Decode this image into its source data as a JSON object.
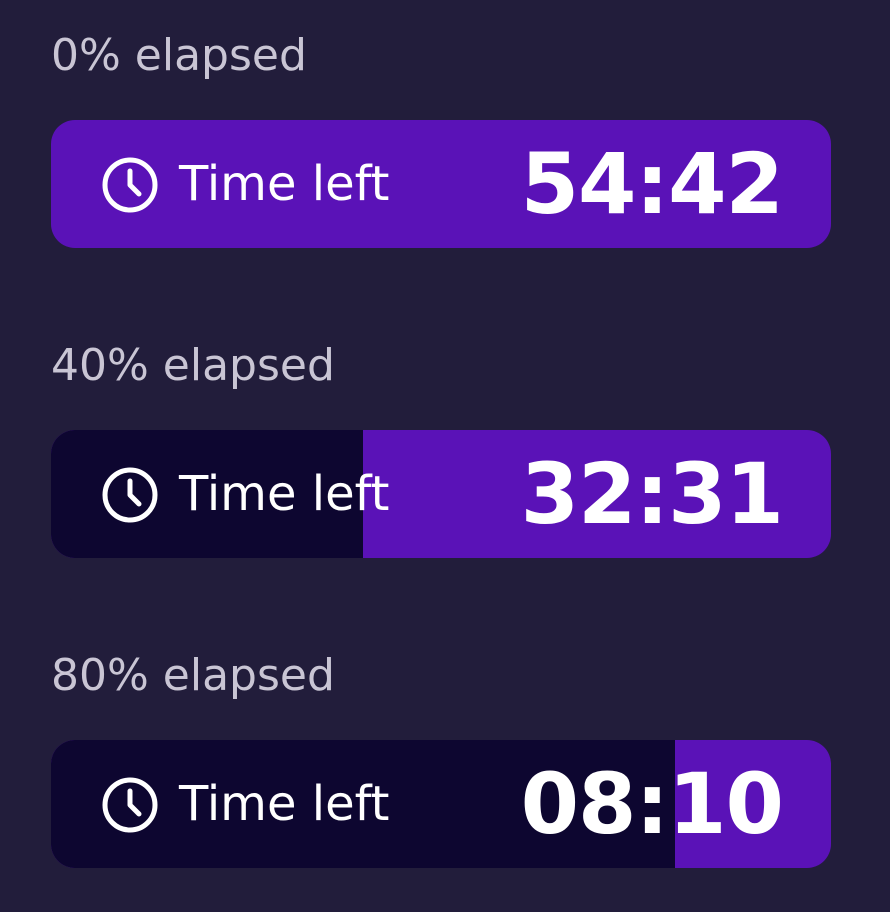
{
  "timers": [
    {
      "caption": "0% elapsed",
      "label": "Time left",
      "time": "54:42",
      "elapsed_fraction": 0.0,
      "icon": "clock-icon"
    },
    {
      "caption": "40% elapsed",
      "label": "Time left",
      "time": "32:31",
      "elapsed_fraction": 0.4,
      "icon": "clock-icon"
    },
    {
      "caption": "80% elapsed",
      "label": "Time left",
      "time": "08:10",
      "elapsed_fraction": 0.8,
      "icon": "clock-icon"
    }
  ],
  "colors": {
    "background": "#221d3b",
    "remaining": "#5a12b7",
    "elapsed": "#0d0630",
    "caption_text": "#c9c5d4",
    "bar_text": "#ffffff"
  }
}
